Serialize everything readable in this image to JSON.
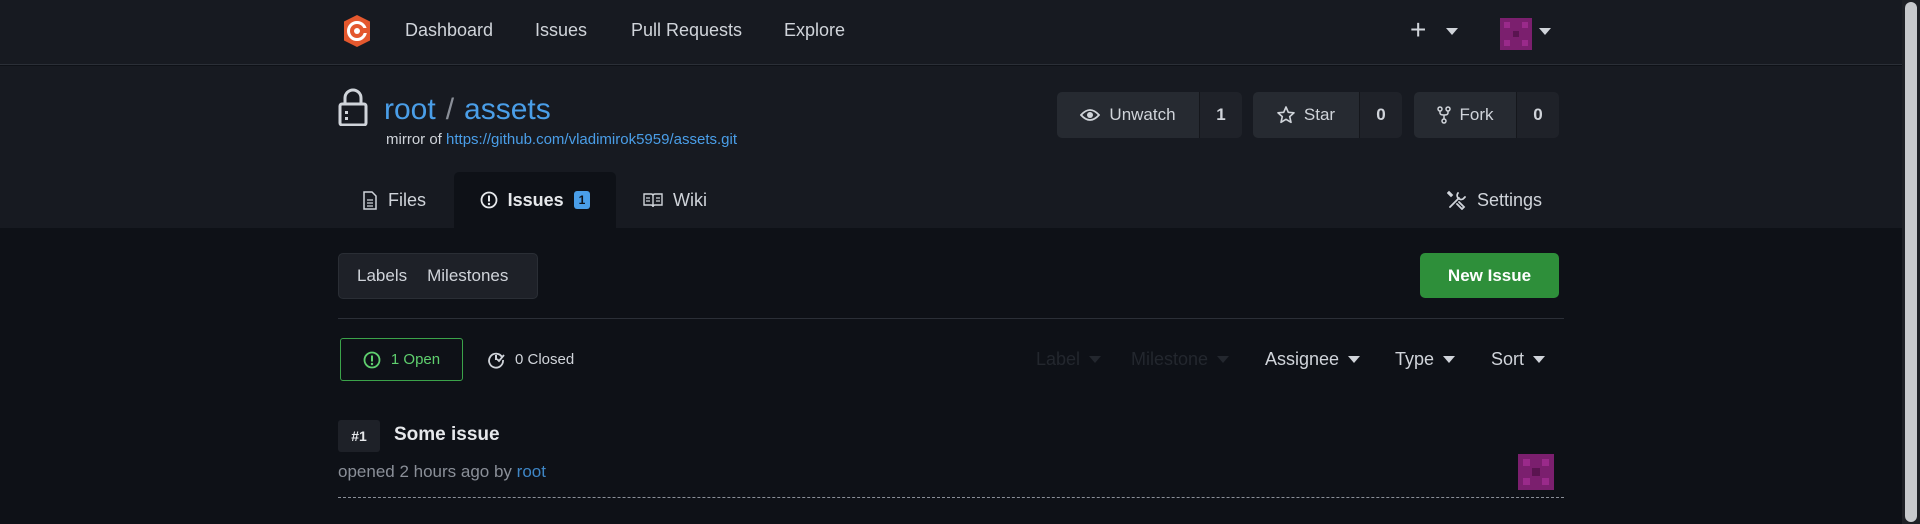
{
  "nav": {
    "items": [
      "Dashboard",
      "Issues",
      "Pull Requests",
      "Explore"
    ],
    "plus": "+"
  },
  "repo": {
    "owner": "root",
    "separator": "/",
    "name": "assets",
    "mirror_label": "mirror of",
    "mirror_url": "https://github.com/vladimirok5959/assets.git",
    "watch_label": "Unwatch",
    "watch_count": "1",
    "star_label": "Star",
    "star_count": "0",
    "fork_label": "Fork",
    "fork_count": "0"
  },
  "tabs": {
    "files": "Files",
    "issues": "Issues",
    "issues_badge": "1",
    "wiki": "Wiki",
    "settings": "Settings"
  },
  "issues_page": {
    "labels": "Labels",
    "milestones": "Milestones",
    "new_issue": "New Issue",
    "open": "1 Open",
    "closed": "0 Closed",
    "filters": {
      "label": "Label",
      "milestone": "Milestone",
      "assignee": "Assignee",
      "type": "Type",
      "sort": "Sort"
    },
    "issues": [
      {
        "number": "#1",
        "title": "Some issue",
        "meta_prefix": "opened 2 hours ago by",
        "author": "root"
      }
    ]
  },
  "colors": {
    "accent": "#4a9ee8",
    "success": "#2e8f3a",
    "logo": "#e4582e",
    "avatar": "#7b1f6e"
  }
}
